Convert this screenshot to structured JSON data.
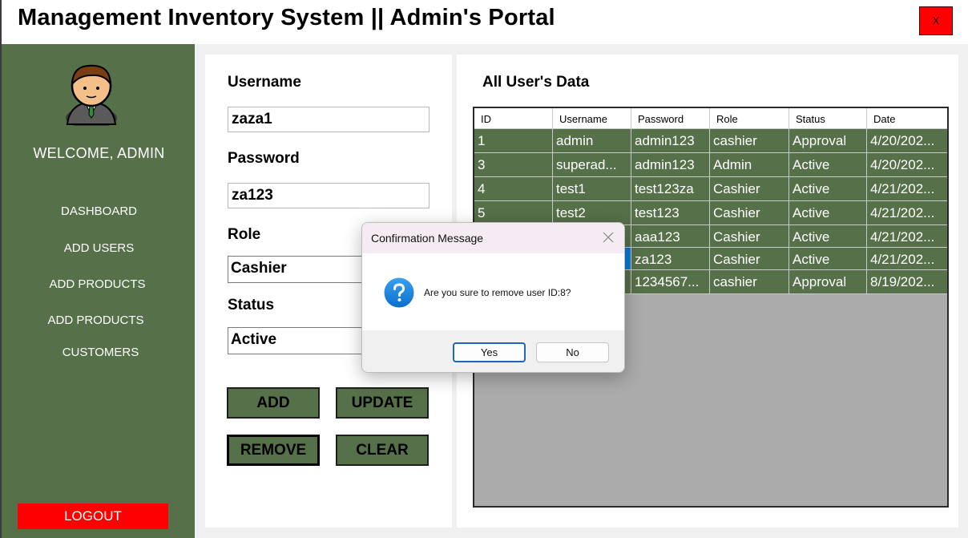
{
  "app": {
    "title": "Management Inventory System || Admin's Portal",
    "close_label": "X"
  },
  "colors": {
    "sidebar": "#567049",
    "danger": "#ff0000",
    "row": "#567049",
    "selected_cell": "#0a78d4",
    "grid_background": "#ababab"
  },
  "sidebar": {
    "avatar_icon": "user-avatar-icon",
    "welcome": "WELCOME,  ADMIN",
    "nav": [
      "DASHBOARD",
      "ADD USERS",
      "ADD PRODUCTS",
      "ADD PRODUCTS",
      "CUSTOMERS"
    ],
    "logout": "LOGOUT"
  },
  "form": {
    "username_label": "Username",
    "username_value": "zaza1",
    "password_label": "Password",
    "password_value": "za123",
    "role_label": "Role",
    "role_value": "Cashier",
    "status_label": "Status",
    "status_value": "Active",
    "buttons": {
      "add": "ADD",
      "update": "UPDATE",
      "remove": "REMOVE",
      "clear": "CLEAR"
    }
  },
  "table": {
    "title": "All User's Data",
    "columns": [
      "ID",
      "Username",
      "Password",
      "Role",
      "Status",
      "Date"
    ],
    "rows": [
      [
        "1",
        "admin",
        "admin123",
        "cashier",
        "Approval",
        "4/20/202..."
      ],
      [
        "3",
        "superad...",
        "admin123",
        "Admin",
        "Active",
        "4/20/202..."
      ],
      [
        "4",
        "test1",
        "test123za",
        "Cashier",
        "Active",
        "4/21/202..."
      ],
      [
        "5",
        "test2",
        "test123",
        "Cashier",
        "Active",
        "4/21/202..."
      ],
      [
        "",
        "",
        "aaa123",
        "Cashier",
        "Active",
        "4/21/202..."
      ],
      [
        "",
        "",
        "za123",
        "Cashier",
        "Active",
        "4/21/202..."
      ],
      [
        "",
        "",
        "1234567...",
        "cashier",
        "Approval",
        "8/19/202..."
      ]
    ]
  },
  "dialog": {
    "title": "Confirmation Message",
    "icon": "question-icon",
    "message": "Are you sure to remove user ID:8?",
    "yes": "Yes",
    "no": "No"
  }
}
